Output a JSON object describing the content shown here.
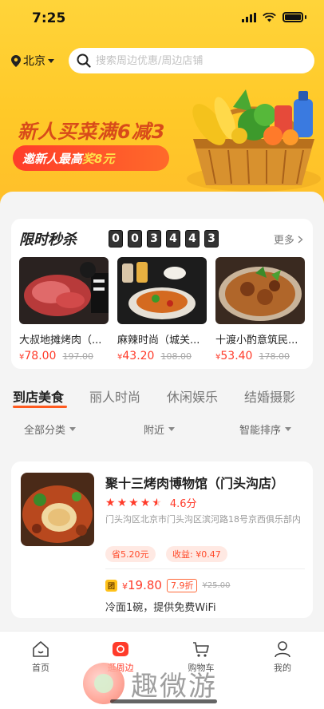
{
  "status": {
    "time": "7:25"
  },
  "location": {
    "city": "北京"
  },
  "search": {
    "placeholder": "搜索周边优惠/周边店铺"
  },
  "promo": {
    "title": "新人买菜满6减3",
    "pill_prefix": "邀新人最高",
    "pill_highlight": "奖8元"
  },
  "flash_sale": {
    "title": "限时秒杀",
    "countdown": [
      "0",
      "0",
      "3",
      "4",
      "4",
      "3"
    ],
    "more": "更多",
    "items": [
      {
        "name": "大叔地摊烤肉（...",
        "currency": "¥",
        "price": "78.00",
        "old_price": "197.00"
      },
      {
        "name": "麻辣时尚（城关...",
        "currency": "¥",
        "price": "43.20",
        "old_price": "108.00"
      },
      {
        "name": "十渡小酌意筑民...",
        "currency": "¥",
        "price": "53.40",
        "old_price": "178.00"
      }
    ]
  },
  "category_tabs": [
    "到店美食",
    "丽人时尚",
    "休闲娱乐",
    "结婚摄影"
  ],
  "filters": [
    "全部分类",
    "附近",
    "智能排序"
  ],
  "shop": {
    "name": "聚十三烤肉博物馆（门头沟店）",
    "rating": "4.6分",
    "address": "门头沟区北京市门头沟区滨河路18号京西俱乐部内",
    "tag_save": "省5.20元",
    "tag_earn": "收益: ¥0.47",
    "deal_badge": "团",
    "currency": "¥",
    "deal_price": "19.80",
    "discount": "7.9折",
    "deal_old_price": "¥25.00",
    "deal_desc": "冷面1碗，提供免费WiFi"
  },
  "tabbar": [
    {
      "label": "首页",
      "icon": "home-icon"
    },
    {
      "label": "逛周边",
      "icon": "nearby-icon"
    },
    {
      "label": "购物车",
      "icon": "cart-icon"
    },
    {
      "label": "我的",
      "icon": "user-icon"
    }
  ],
  "watermark": {
    "text": "趣微游"
  },
  "colors": {
    "brand_yellow": "#ffc928",
    "accent_red": "#ff3b2a",
    "accent_orange": "#ff5a1f"
  }
}
